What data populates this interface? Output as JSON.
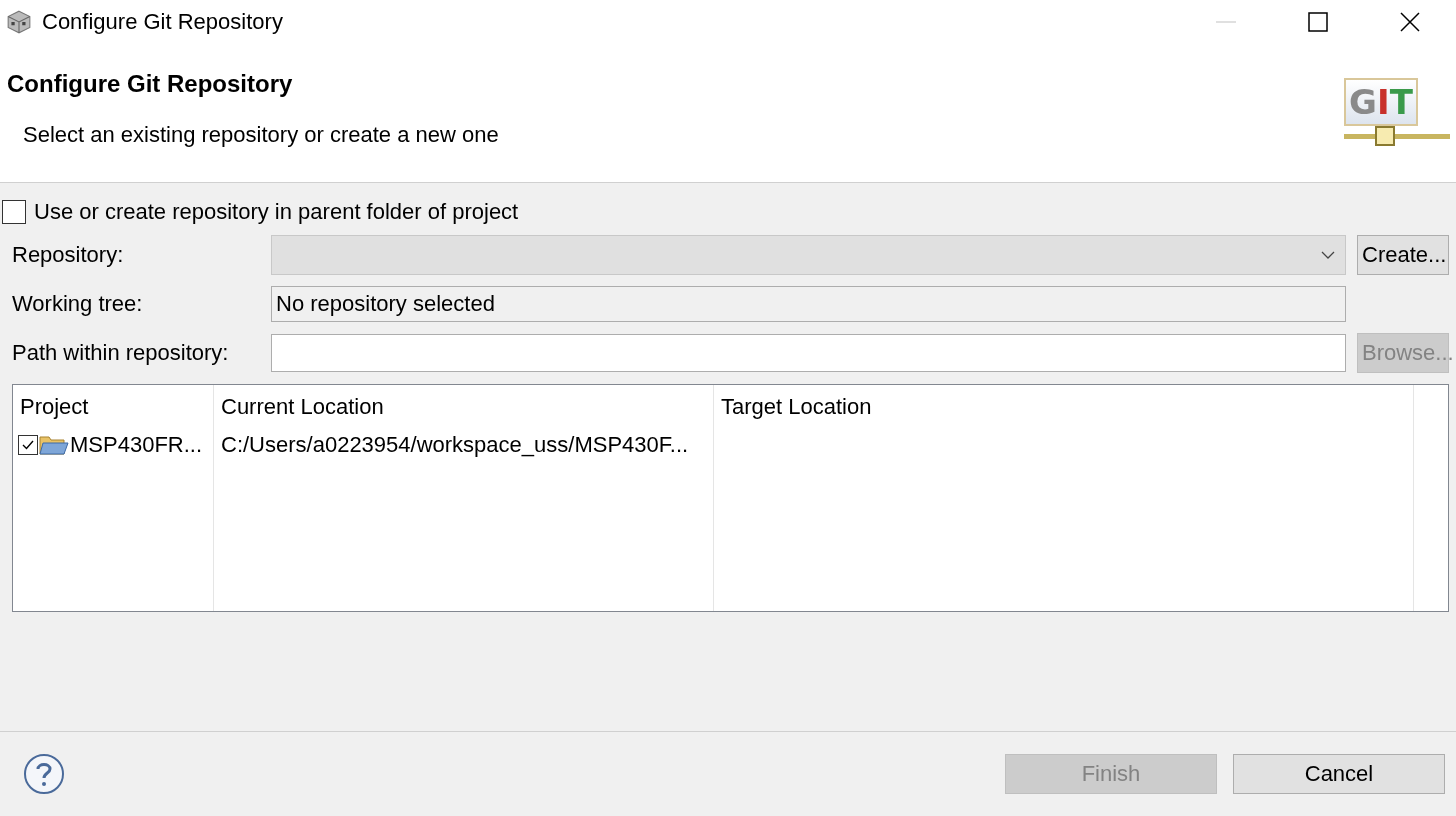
{
  "window": {
    "title": "Configure Git Repository",
    "minimize_disabled": true
  },
  "header": {
    "title": "Configure Git Repository",
    "subtitle": "Select an existing repository or create a new one",
    "logo_text": "GIT"
  },
  "parent_folder_option": {
    "label": "Use or create repository in parent folder of project",
    "checked": false
  },
  "fields": [
    {
      "kind": "combo",
      "label": "Repository:",
      "disabled": true,
      "button": {
        "label": "Create...",
        "disabled": false
      }
    },
    {
      "kind": "readonly",
      "label": "Working tree:",
      "value": "No repository selected"
    },
    {
      "kind": "text",
      "label": "Path within repository:",
      "button": {
        "label": "Browse...",
        "disabled": true
      }
    }
  ],
  "table": {
    "columns": [
      "Project",
      "Current Location",
      "Target Location"
    ],
    "rows": [
      {
        "checked": true,
        "project": "MSP430FR...",
        "current_location": "C:/Users/a0223954/workspace_uss/MSP430F..."
      }
    ]
  },
  "buttons": [
    {
      "label": "Finish",
      "disabled": true
    },
    {
      "label": "Cancel",
      "disabled": false
    }
  ]
}
